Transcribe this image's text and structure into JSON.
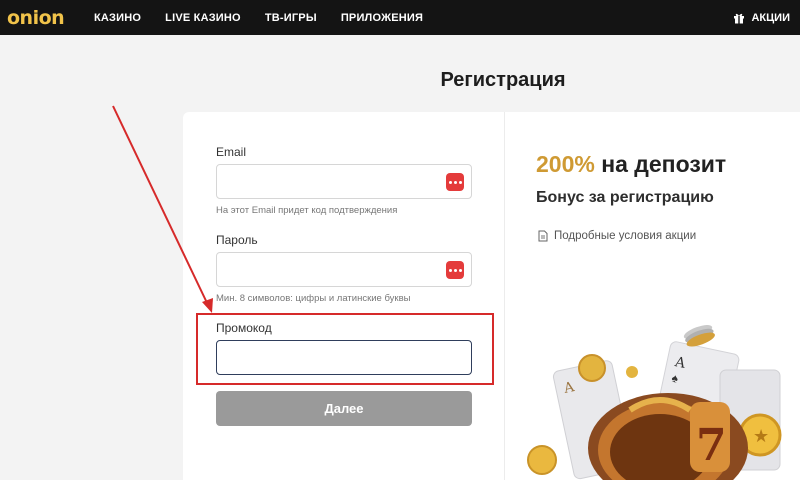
{
  "nav": {
    "logo": "onion",
    "items": [
      "КАЗИНО",
      "LIVE КАЗИНО",
      "ТВ-ИГРЫ",
      "ПРИЛОЖЕНИЯ"
    ],
    "promo_label": "АКЦИИ"
  },
  "page": {
    "title": "Регистрация"
  },
  "form": {
    "email_label": "Email",
    "email_hint": "На этот Email придет код подтверждения",
    "password_label": "Пароль",
    "password_hint": "Мин. 8 символов: цифры и латинские буквы",
    "promo_label": "Промокод",
    "next_button": "Далее"
  },
  "bonus": {
    "percent": "200%",
    "title_rest": "на депозит",
    "subtitle": "Бонус за регистрацию",
    "terms_link": "Подробные условия акции"
  },
  "colors": {
    "accent_gold": "#cf9a33",
    "highlight_red": "#d62a2a",
    "nav_bg": "#141414"
  },
  "icons": [
    "gift-icon",
    "password-manager-icon",
    "document-icon"
  ]
}
